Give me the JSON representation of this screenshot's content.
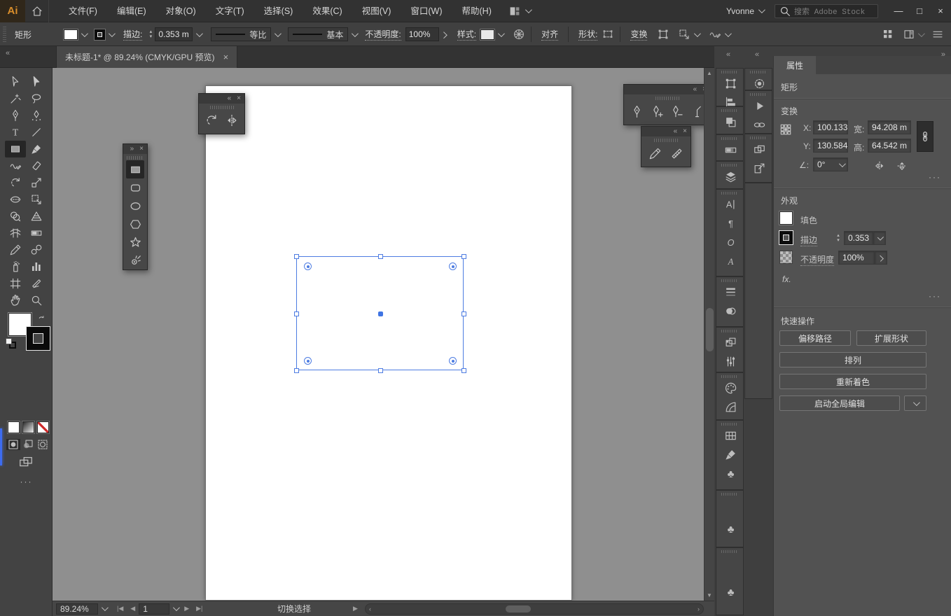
{
  "colors": {
    "selection_blue": "#4d7ce2",
    "accent_blue": "#3d6cf0",
    "panel_bg": "#525252"
  },
  "titlebar": {
    "logo_text": "Ai",
    "menus": [
      "文件(F)",
      "编辑(E)",
      "对象(O)",
      "文字(T)",
      "选择(S)",
      "效果(C)",
      "视图(V)",
      "窗口(W)",
      "帮助(H)"
    ],
    "user_name": "Yvonne",
    "search_placeholder": "搜索 Adobe Stock",
    "window_controls": {
      "minimize": "—",
      "maximize": "□",
      "close": "×"
    }
  },
  "controlbar": {
    "selection_type": "矩形",
    "stroke_label": "描边:",
    "stroke_weight": "0.353 m",
    "variable_width_profile": "等比",
    "brush_definition": "基本",
    "opacity_label": "不透明度:",
    "opacity_value": "100%",
    "style_label": "样式:",
    "align_label": "对齐",
    "shape_label": "形状:",
    "transform_label": "变换"
  },
  "document_tab": {
    "title": "未标题-1* @ 89.24% (CMYK/GPU 预览)",
    "close": "×"
  },
  "toolbar": {
    "tools": [
      {
        "name": "direct-selection-tool",
        "icon": "cursorOutline"
      },
      {
        "name": "selection-tool",
        "icon": "cursorFilled"
      },
      {
        "name": "magic-wand-tool",
        "icon": "wand"
      },
      {
        "name": "lasso-tool",
        "icon": "lasso"
      },
      {
        "name": "pen-tool",
        "icon": "pen"
      },
      {
        "name": "curvature-tool",
        "icon": "curvature"
      },
      {
        "name": "type-tool",
        "icon": "type"
      },
      {
        "name": "line-segment-tool",
        "icon": "line"
      },
      {
        "name": "rectangle-tool",
        "icon": "rectTool",
        "selected": true
      },
      {
        "name": "paintbrush-tool",
        "icon": "brush"
      },
      {
        "name": "shaper-tool",
        "icon": "shaper"
      },
      {
        "name": "eraser-tool",
        "icon": "eraser"
      },
      {
        "name": "rotate-tool",
        "icon": "rotate"
      },
      {
        "name": "scale-tool",
        "icon": "scale"
      },
      {
        "name": "width-tool",
        "icon": "widthTool"
      },
      {
        "name": "free-transform-tool",
        "icon": "freeTransform"
      },
      {
        "name": "shape-builder-tool",
        "icon": "shapeBuilder"
      },
      {
        "name": "perspective-grid-tool",
        "icon": "perspective"
      },
      {
        "name": "mesh-tool",
        "icon": "mesh"
      },
      {
        "name": "gradient-tool",
        "icon": "gradientIc"
      },
      {
        "name": "eyedropper-tool",
        "icon": "eyedropper"
      },
      {
        "name": "blend-tool",
        "icon": "blend"
      },
      {
        "name": "symbol-sprayer-tool",
        "icon": "spray"
      },
      {
        "name": "column-graph-tool",
        "icon": "graph"
      },
      {
        "name": "artboard-tool",
        "icon": "artboardTool"
      },
      {
        "name": "slice-tool",
        "icon": "slice"
      },
      {
        "name": "hand-tool",
        "icon": "hand"
      },
      {
        "name": "zoom-tool",
        "icon": "zoomTool"
      }
    ]
  },
  "floating_panels": {
    "rotate_panel": {
      "tools": [
        {
          "name": "rotate-tool",
          "icon": "rotate"
        },
        {
          "name": "reflect-tool",
          "icon": "reflect"
        }
      ]
    },
    "shapes_panel": {
      "tools": [
        {
          "name": "rectangle-tool",
          "icon": "rectTool",
          "selected": true
        },
        {
          "name": "rounded-rectangle-tool",
          "icon": "roundRect"
        },
        {
          "name": "ellipse-tool",
          "icon": "ellipseShape"
        },
        {
          "name": "polygon-tool",
          "icon": "polygonShape"
        },
        {
          "name": "star-tool",
          "icon": "starShape"
        },
        {
          "name": "flare-tool",
          "icon": "flareShape"
        }
      ]
    },
    "pen_panel": {
      "tools": [
        {
          "name": "pen-tool",
          "icon": "pen"
        },
        {
          "name": "add-anchor-point-tool",
          "icon": "penPlus"
        },
        {
          "name": "delete-anchor-point-tool",
          "icon": "penMinus"
        },
        {
          "name": "anchor-point-tool",
          "icon": "anchorPoint"
        }
      ]
    },
    "eyedropper_panel": {
      "tools": [
        {
          "name": "eyedropper-tool",
          "icon": "eyedropper"
        },
        {
          "name": "measure-tool",
          "icon": "measure"
        }
      ]
    }
  },
  "dock": {
    "column1_groups": [
      [
        {
          "name": "transform-panel",
          "icon": "transformP"
        },
        {
          "name": "align-panel",
          "icon": "alignP"
        }
      ],
      [
        {
          "name": "pathfinder-panel",
          "icon": "pathfinderP"
        }
      ],
      [
        {
          "name": "gradient-panel",
          "icon": "gradientIc"
        }
      ],
      [
        {
          "name": "layers-panel",
          "icon": "layersP"
        }
      ],
      [
        {
          "name": "character-panel",
          "icon": "charP"
        },
        {
          "name": "paragraph-panel",
          "icon": "paraP"
        },
        {
          "name": "opentype-panel",
          "icon": "otP"
        },
        {
          "name": "glyphs-panel",
          "icon": "glyphsP"
        }
      ],
      [
        {
          "name": "stroke-panel",
          "icon": "strokeP"
        },
        {
          "name": "transparency-panel",
          "icon": "transparencyP"
        }
      ],
      [
        {
          "name": "style-libraries-panel",
          "icon": "symbolsSq"
        },
        {
          "name": "appearance-panel",
          "icon": "appearanceP"
        }
      ],
      [
        {
          "name": "swatches-panel",
          "icon": "swatchesP"
        },
        {
          "name": "color-guide-panel",
          "icon": "colorGuideP"
        }
      ],
      [
        {
          "name": "pattern-options-panel",
          "icon": "patternP"
        },
        {
          "name": "brushes-panel",
          "icon": "brush"
        },
        {
          "name": "symbols-panel",
          "icon": "clubP"
        }
      ],
      [
        {
          "name": "symbol-libraries-panel",
          "icon": "clubP"
        }
      ],
      [
        {
          "name": "graphic-style-libraries-panel",
          "icon": "clubP"
        }
      ]
    ],
    "column2_groups": [
      [
        {
          "name": "color-panel",
          "icon": "colorP"
        }
      ],
      [
        {
          "name": "actions-panel",
          "icon": "actionsP"
        },
        {
          "name": "links-panel",
          "icon": "linksP"
        }
      ],
      [
        {
          "name": "artboards-panel",
          "icon": "artboardsP"
        },
        {
          "name": "asset-export-panel",
          "icon": "exportP"
        }
      ]
    ]
  },
  "properties": {
    "panel_title": "属性",
    "object_type": "矩形",
    "transform": {
      "section_title": "变换",
      "x_label": "X:",
      "x_value": "100.133",
      "y_label": "Y:",
      "y_value": "130.584",
      "width_label": "宽:",
      "width_value": "94.208 m",
      "height_label": "高:",
      "height_value": "64.542 m",
      "angle_label": "∠:",
      "angle_value": "0°"
    },
    "appearance": {
      "section_title": "外观",
      "fill_label": "填色",
      "stroke_label": "描边",
      "stroke_value": "0.353",
      "opacity_label": "不透明度",
      "opacity_value": "100%",
      "fx_label": "fx."
    },
    "quick_actions": {
      "section_title": "快速操作",
      "buttons": [
        {
          "label": "偏移路径"
        },
        {
          "label": "扩展形状"
        },
        {
          "label": "排列"
        },
        {
          "label": "重新着色"
        },
        {
          "label": "启动全局编辑",
          "has_dropdown": true
        }
      ]
    }
  },
  "statusbar": {
    "zoom_level": "89.24%",
    "artboard_number": "1",
    "status_text": "切换选择"
  }
}
